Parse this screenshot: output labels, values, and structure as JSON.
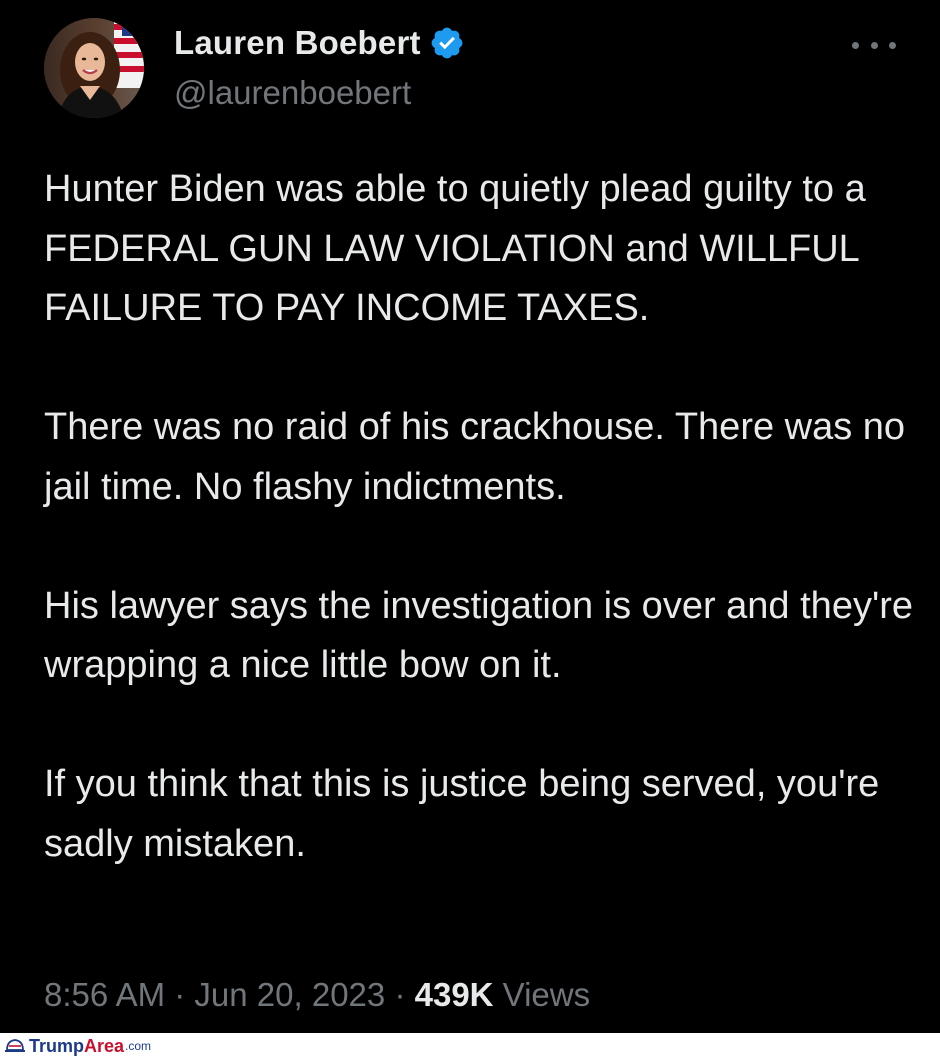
{
  "tweet": {
    "display_name": "Lauren Boebert",
    "handle": "@laurenboebert",
    "verified_icon": "verified-badge-icon",
    "more_icon": "more-options-icon",
    "paragraphs": [
      "Hunter Biden was able to quietly plead guilty to a FEDERAL GUN LAW VIOLATION and WILLFUL FAILURE TO PAY INCOME TAXES.",
      "There was no raid of his crackhouse. There was no jail time. No flashy indictments.",
      "His lawyer says the investigation is over and they're wrapping a nice little bow on it.",
      "If you think that this is justice being served, you're sadly mistaken."
    ],
    "time": "8:56 AM",
    "date": "Jun 20, 2023",
    "separator": "·",
    "views_count": "439K",
    "views_label": "Views"
  },
  "watermark": {
    "part1": "Trump",
    "part2": "Area",
    "part3": ".com"
  },
  "colors": {
    "background": "#000000",
    "text": "#e7e9ea",
    "muted": "#71767b",
    "verified": "#1d9bf0"
  }
}
